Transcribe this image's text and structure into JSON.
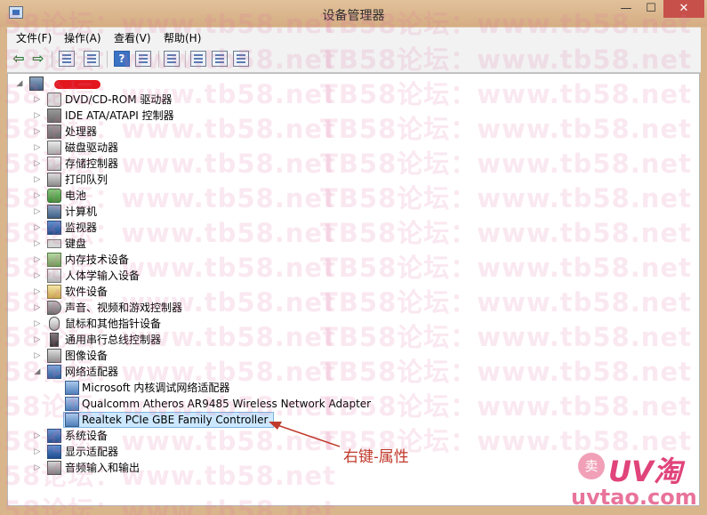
{
  "window": {
    "title": "设备管理器",
    "min_glyph": "—",
    "max_glyph": "☐",
    "close_glyph": "✕"
  },
  "menu": [
    {
      "label": "文件(F)"
    },
    {
      "label": "操作(A)"
    },
    {
      "label": "查看(V)"
    },
    {
      "label": "帮助(H)"
    }
  ],
  "toolbar": {
    "back_glyph": "⇦",
    "forward_glyph": "⇨",
    "help_glyph": "?",
    "icons": [
      "back-icon",
      "forward-icon",
      "properties-icon",
      "update-icon",
      "help-icon",
      "view-icon",
      "scan-hardware-icon",
      "update-driver-icon",
      "uninstall-icon",
      "disable-icon"
    ]
  },
  "tree": {
    "expander_collapsed": "▷",
    "expander_expanded": "◢",
    "categories": [
      {
        "label": "DVD/CD-ROM 驱动器",
        "icon": "disc-drive-icon"
      },
      {
        "label": "IDE ATA/ATAPI 控制器",
        "icon": "ide-controller-icon"
      },
      {
        "label": "处理器",
        "icon": "processor-icon"
      },
      {
        "label": "磁盘驱动器",
        "icon": "disk-drive-icon"
      },
      {
        "label": "存储控制器",
        "icon": "storage-controller-icon"
      },
      {
        "label": "打印队列",
        "icon": "printer-icon"
      },
      {
        "label": "电池",
        "icon": "battery-icon"
      },
      {
        "label": "计算机",
        "icon": "computer-icon"
      },
      {
        "label": "监视器",
        "icon": "monitor-icon"
      },
      {
        "label": "键盘",
        "icon": "keyboard-icon"
      },
      {
        "label": "内存技术设备",
        "icon": "memory-icon"
      },
      {
        "label": "人体学输入设备",
        "icon": "hid-icon"
      },
      {
        "label": "软件设备",
        "icon": "software-device-icon"
      },
      {
        "label": "声音、视频和游戏控制器",
        "icon": "sound-icon"
      },
      {
        "label": "鼠标和其他指针设备",
        "icon": "mouse-icon"
      },
      {
        "label": "通用串行总线控制器",
        "icon": "usb-icon"
      },
      {
        "label": "图像设备",
        "icon": "camera-icon"
      },
      {
        "label": "网络适配器",
        "icon": "network-adapter-icon",
        "expanded": true
      }
    ],
    "network_children": [
      {
        "label": "Microsoft 内核调试网络适配器"
      },
      {
        "label": "Qualcomm Atheros AR9485 Wireless Network Adapter"
      },
      {
        "label": "Realtek PCIe GBE Family Controller",
        "selected": true
      }
    ],
    "after_categories": [
      {
        "label": "系统设备",
        "icon": "system-device-icon"
      },
      {
        "label": "显示适配器",
        "icon": "display-adapter-icon"
      },
      {
        "label": "音频输入和输出",
        "icon": "audio-io-icon"
      }
    ]
  },
  "annotation": {
    "text": "右键-属性",
    "color": "#c0392b"
  },
  "watermark": {
    "text": "TB58论坛：www.tb58.net",
    "color": "#e16ea0"
  },
  "logo": {
    "badge": "卖",
    "text": "UV淘",
    "url": "uvtao.com"
  }
}
